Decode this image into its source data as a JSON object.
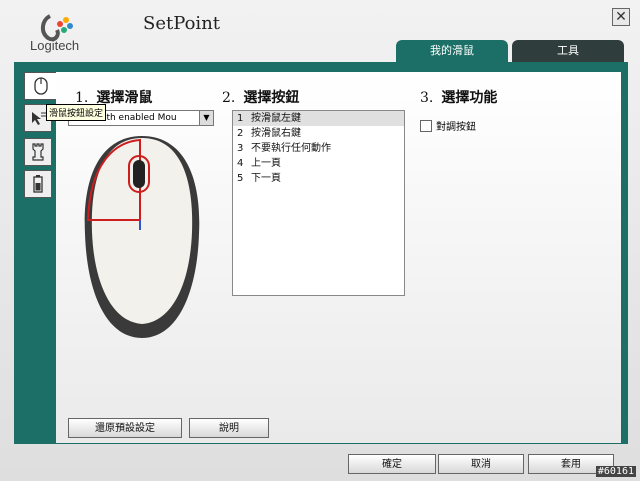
{
  "app": {
    "brand": "Logitech",
    "title": "SetPoint",
    "close_glyph": "✕"
  },
  "tabs": [
    {
      "label": "我的滑鼠"
    },
    {
      "label": "工具"
    }
  ],
  "sidebar": [
    {
      "icon": "mouse-icon",
      "tooltip": "滑鼠按鈕設定"
    },
    {
      "icon": "pointer-speed-icon"
    },
    {
      "icon": "game-rook-icon"
    },
    {
      "icon": "battery-icon"
    }
  ],
  "section1": {
    "number": "1.",
    "title": "選擇滑鼠",
    "select_value": "Bluetooth enabled Mou"
  },
  "section2": {
    "number": "2.",
    "title": "選擇按鈕",
    "items": [
      {
        "n": "1",
        "label": "按滑鼠左鍵"
      },
      {
        "n": "2",
        "label": "按滑鼠右鍵"
      },
      {
        "n": "3",
        "label": "不要執行任何動作"
      },
      {
        "n": "4",
        "label": "上一頁"
      },
      {
        "n": "5",
        "label": "下一頁"
      }
    ]
  },
  "section3": {
    "number": "3.",
    "title": "選擇功能",
    "checkbox_label": "對調按鈕"
  },
  "buttons": {
    "restore": "還原預設設定",
    "help": "說明",
    "ok": "確定",
    "cancel": "取消",
    "apply": "套用"
  },
  "watermark": "#60161"
}
